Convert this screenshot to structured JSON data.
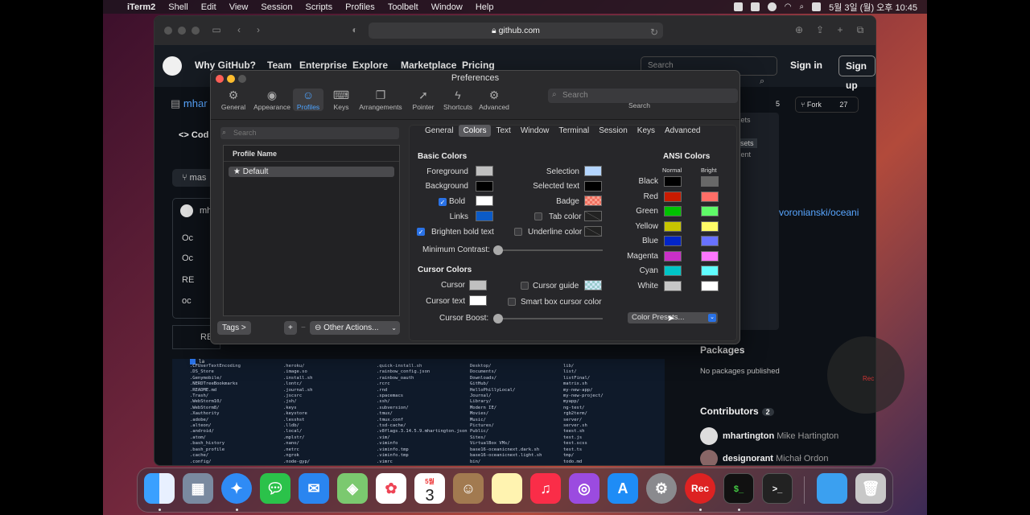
{
  "menubar": {
    "app": "iTerm2",
    "items": [
      "Shell",
      "Edit",
      "View",
      "Session",
      "Scripts",
      "Profiles",
      "Toolbelt",
      "Window",
      "Help"
    ],
    "clock": "5월 3일 (월) 오후 10:45"
  },
  "safari": {
    "url": "github.com"
  },
  "github": {
    "nav": [
      "Why GitHub?",
      "Team",
      "Enterprise",
      "Explore",
      "Marketplace",
      "Pricing"
    ],
    "search_placeholder": "Search",
    "sign_in": "Sign in",
    "sign_up": "Sign up",
    "repo_short": "mhar",
    "fork_label": "Fork",
    "fork_count": "27",
    "star_count": "5",
    "code_tab": "Cod",
    "branch": "mas",
    "author_short": "mh",
    "files": [
      "Oc",
      "Oc",
      "RE",
      "oc"
    ],
    "readme": "RE",
    "side_tags": [
      "resets",
      "resets",
      "ument"
    ],
    "repo_link": "voronianski/oceani",
    "packages_title": "Packages",
    "packages_text": "No packages published",
    "contributors_title": "Contributors",
    "contributors_count": "2",
    "contributors": [
      {
        "login": "mhartington",
        "name": "Mike Hartington"
      },
      {
        "login": "designorant",
        "name": "Michał Ordon"
      }
    ],
    "terminal": {
      "prompt": "la",
      "col1": [
        ".CFUserTextEncoding",
        ".DS_Store",
        ".Genymobile/",
        ".NERDTreeBookmarks",
        ".README.md",
        ".Trash/",
        ".WebStorm10/",
        ".WebStorm8/",
        ".Xauthority",
        ".adobe/",
        ".alteon/",
        ".android/",
        ".atom/",
        ".bash_history",
        ".bash_profile",
        ".cache/",
        ".config/"
      ],
      "col2": [
        ".heroku/",
        ".image.so",
        ".install.sh",
        ".lontc/",
        ".journal.sh",
        ".jscsrc",
        ".jsh/",
        ".keys",
        ".keystore",
        ".lesshst",
        ".lldb/",
        ".local/",
        ".mplstr/",
        ".nano/",
        ".netrc",
        ".ngrok",
        ".node-gyp/"
      ],
      "col3": [
        ".quick-install.sh",
        ".rainbow_config.json",
        ".rainbow_oauth",
        ".rcrc",
        ".rnd",
        ".spacemacs",
        ".ssh/",
        ".subversion/",
        ".tmux/",
        ".tmux.conf",
        ".tsd-cache/",
        ".v8flags.3.14.5.9.mhartington.json",
        ".vim/",
        ".viminfo",
        ".viminfo.tmp",
        ".viminfo.tmp",
        ".vimrc"
      ],
      "col4": [
        "Desktop/",
        "Documents/",
        "Downloads/",
        "GitHub/",
        "HelloPhillyLocal/",
        "Journal/",
        "Library/",
        "Modern IE/",
        "Movies/",
        "Music/",
        "Pictures/",
        "Public/",
        "Sites/",
        "VirtualBox VMs/",
        "base16-oceanicnext.dark.sh",
        "base16-oceanicnext.light.sh",
        "bin/"
      ],
      "col5": [
        "lib/",
        "list/",
        "listFinal/",
        "matrix.sh",
        "my-new-app/",
        "my-new-project/",
        "myapp/",
        "ng-test/",
        "rgb2term/",
        "server/",
        "server.sh",
        "teest.sh",
        "test.js",
        "test.scss",
        "test.ts",
        "tmp/",
        "todo.md"
      ]
    }
  },
  "prefs": {
    "title": "Preferences",
    "toolbar": [
      "General",
      "Appearance",
      "Profiles",
      "Keys",
      "Arrangements",
      "Pointer",
      "Shortcuts",
      "Advanced"
    ],
    "search_placeholder": "Search",
    "search_label": "Search",
    "profile_filter_placeholder": "Search",
    "profile_header": "Profile Name",
    "profile_default": "★ Default",
    "tags_button": "Tags >",
    "add_button": "+",
    "remove_button": "−",
    "other_actions": "⊖ Other Actions...",
    "tabs": [
      "General",
      "Colors",
      "Text",
      "Window",
      "Terminal",
      "Session",
      "Keys",
      "Advanced"
    ],
    "basic_colors": {
      "title": "Basic Colors",
      "foreground": "Foreground",
      "background": "Background",
      "bold": "Bold",
      "links": "Links",
      "selection": "Selection",
      "selected_text": "Selected text",
      "badge": "Badge",
      "tab_color": "Tab color",
      "underline_color": "Underline color",
      "brighten_bold": "Brighten bold text",
      "min_contrast": "Minimum Contrast:",
      "colors": {
        "foreground": "#c0c0c0",
        "background": "#000000",
        "bold": "#ffffff",
        "links": "#0b5bc7",
        "selection": "#b4d5fe",
        "selected_text": "#000000"
      }
    },
    "cursor_colors": {
      "title": "Cursor Colors",
      "cursor": "Cursor",
      "cursor_text": "Cursor text",
      "cursor_guide": "Cursor guide",
      "smart_box": "Smart box cursor color",
      "boost": "Cursor Boost:",
      "colors": {
        "cursor": "#c0c0c0",
        "cursor_text": "#ffffff"
      }
    },
    "ansi": {
      "title": "ANSI Colors",
      "normal": "Normal",
      "bright": "Bright",
      "rows": [
        {
          "name": "Black",
          "normal": "#000000",
          "bright": "#686868"
        },
        {
          "name": "Red",
          "normal": "#c91b00",
          "bright": "#ff6e67"
        },
        {
          "name": "Green",
          "normal": "#00c200",
          "bright": "#5ffa68"
        },
        {
          "name": "Yellow",
          "normal": "#c7c400",
          "bright": "#fffc67"
        },
        {
          "name": "Blue",
          "normal": "#0225c7",
          "bright": "#6871ff"
        },
        {
          "name": "Magenta",
          "normal": "#c930c7",
          "bright": "#ff77ff"
        },
        {
          "name": "Cyan",
          "normal": "#00c5c7",
          "bright": "#60fdff"
        },
        {
          "name": "White",
          "normal": "#c7c7c7",
          "bright": "#ffffff"
        }
      ]
    },
    "color_presets": "Color Presets..."
  },
  "rec_label": "Rec",
  "dock": {
    "calendar_month": "5월",
    "calendar_day": "3",
    "rec": "Rec",
    "term1": "$_",
    "term2": ">_"
  }
}
